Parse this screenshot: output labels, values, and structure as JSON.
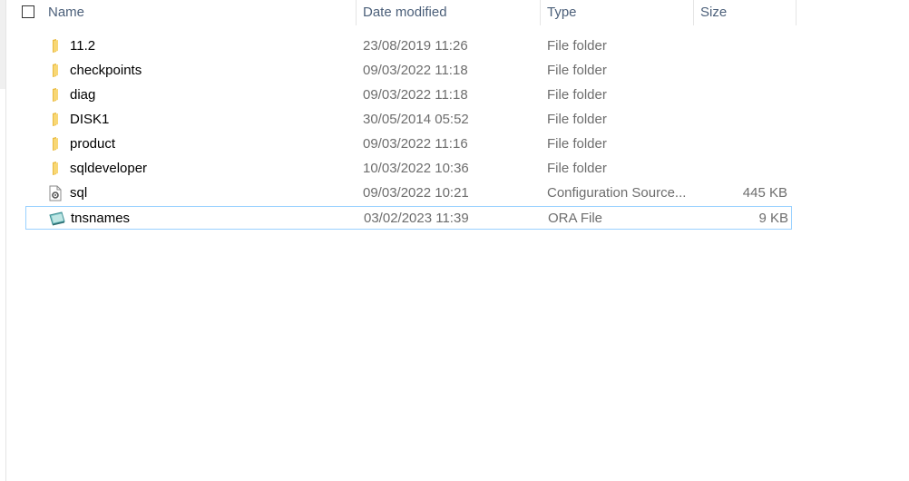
{
  "header": {
    "name_label": "Name",
    "date_label": "Date modified",
    "type_label": "Type",
    "size_label": "Size",
    "sort_indicator": "ˇ"
  },
  "rows": [
    {
      "name": "11.2",
      "date": "23/08/2019 11:26",
      "type": "File folder",
      "size": "",
      "icon": "folder-icon"
    },
    {
      "name": "checkpoints",
      "date": "09/03/2022 11:18",
      "type": "File folder",
      "size": "",
      "icon": "folder-icon"
    },
    {
      "name": "diag",
      "date": "09/03/2022 11:18",
      "type": "File folder",
      "size": "",
      "icon": "folder-icon"
    },
    {
      "name": "DISK1",
      "date": "30/05/2014 05:52",
      "type": "File folder",
      "size": "",
      "icon": "folder-icon"
    },
    {
      "name": "product",
      "date": "09/03/2022 11:16",
      "type": "File folder",
      "size": "",
      "icon": "folder-icon"
    },
    {
      "name": "sqldeveloper",
      "date": "10/03/2022 10:36",
      "type": "File folder",
      "size": "",
      "icon": "folder-icon"
    },
    {
      "name": "sql",
      "date": "09/03/2022 10:21",
      "type": "Configuration Source...",
      "size": "445 KB",
      "icon": "config-file-icon"
    },
    {
      "name": "tnsnames",
      "date": "03/02/2023 11:39",
      "type": "ORA File",
      "size": "9 KB",
      "icon": "ora-file-icon"
    }
  ],
  "colors": {
    "header_text": "#4c607a",
    "selection_border": "#99d1ff",
    "folder_yellow": "#f8d775"
  }
}
